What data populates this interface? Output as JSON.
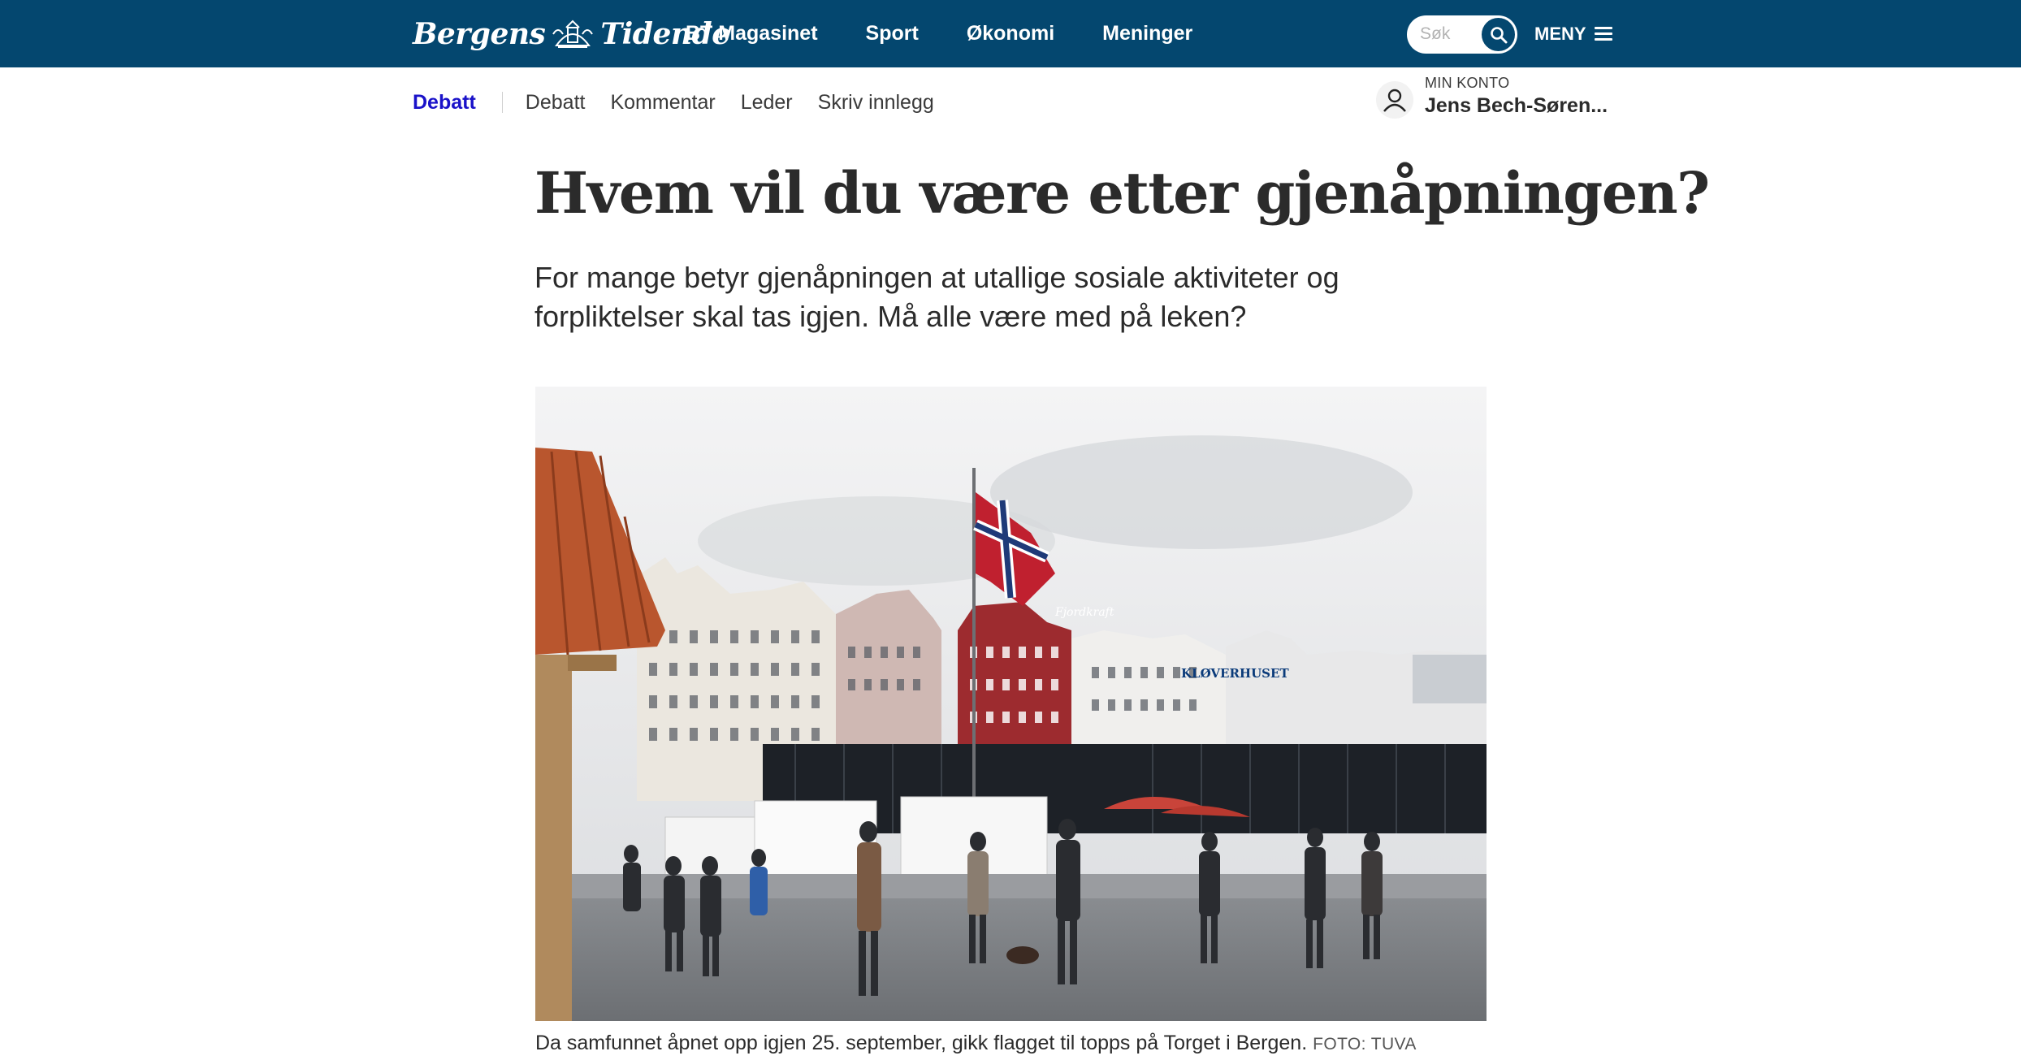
{
  "header": {
    "logo_text_left": "Bergens",
    "logo_text_right": "Tidende",
    "nav": [
      {
        "label": "BT Magasinet"
      },
      {
        "label": "Sport"
      },
      {
        "label": "Økonomi"
      },
      {
        "label": "Meninger"
      }
    ],
    "search": {
      "placeholder": "Søk",
      "value": ""
    },
    "menu_label": "MENY",
    "colors": {
      "brand": "#04476f"
    }
  },
  "subnav": {
    "section": "Debatt",
    "items": [
      {
        "label": "Debatt"
      },
      {
        "label": "Kommentar"
      },
      {
        "label": "Leder"
      },
      {
        "label": "Skriv innlegg"
      }
    ],
    "section_color": "#1a12c9"
  },
  "account": {
    "label": "MIN KONTO",
    "name": "Jens Bech-Søren..."
  },
  "article": {
    "title": "Hvem vil du være etter gjenåpningen?",
    "lead": "For mange betyr gjenåpningen at utallige sosiale aktiviteter og forpliktelser skal tas igjen. Må alle være med på leken?",
    "image": {
      "sign_text_1": "Fjordkraft",
      "sign_text_2": "KLØVERHUSET"
    },
    "caption": "Da samfunnet åpnet opp igjen 25. september, gikk flagget til topps på Torget i Bergen.",
    "credit": "FOTO: TUVA"
  }
}
